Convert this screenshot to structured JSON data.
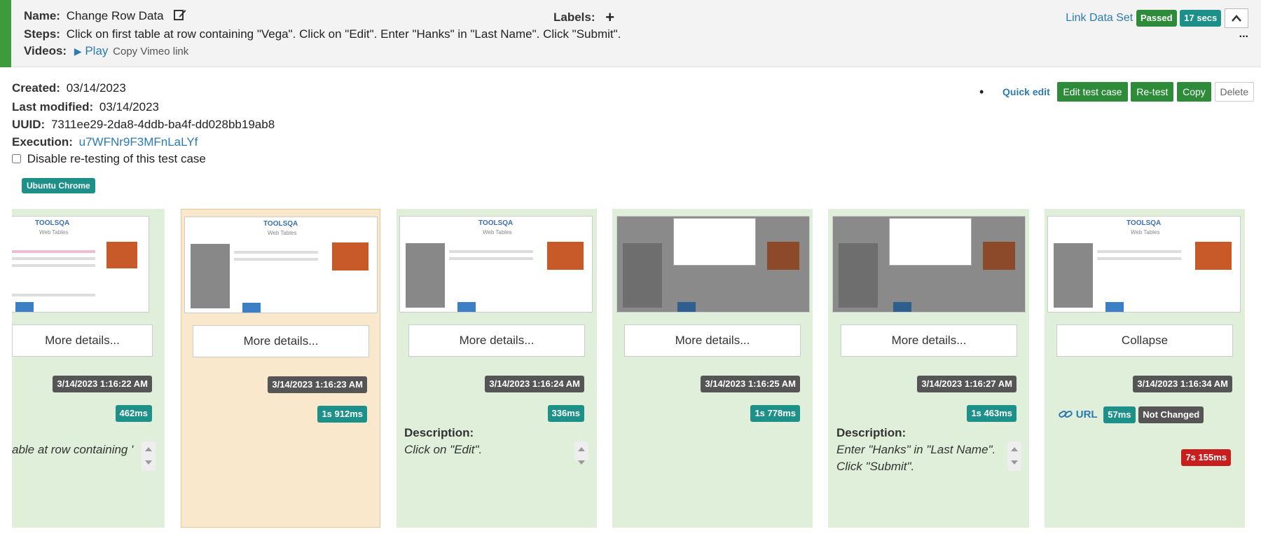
{
  "header": {
    "name_label": "Name:",
    "name_value": "Change Row Data",
    "labels_label": "Labels:",
    "steps_label": "Steps:",
    "steps_value": "Click on first table at row containing \"Vega\". Click on \"Edit\". Enter \"Hanks\" in \"Last Name\". Click \"Submit\".",
    "videos_label": "Videos:",
    "play_label": "Play",
    "copy_vimeo": "Copy Vimeo link",
    "link_data_set": "Link Data Set",
    "status_badge": "Passed",
    "duration_badge": "17 secs",
    "more_menu": "..."
  },
  "meta": {
    "created_label": "Created:",
    "created_value": "03/14/2023",
    "modified_label": "Last modified:",
    "modified_value": "03/14/2023",
    "uuid_label": "UUID:",
    "uuid_value": "7311ee29-2da8-4ddb-ba4f-dd028bb19ab8",
    "execution_label": "Execution:",
    "execution_value": "u7WFNr9F3MFnLaLYf",
    "disable_retest_label": "Disable re-testing of this test case",
    "browser_badge": "Ubuntu Chrome"
  },
  "actions": {
    "bullet": "•",
    "quick_edit": "Quick edit",
    "edit_test_case": "Edit test case",
    "retest": "Re-test",
    "copy": "Copy",
    "delete": "Delete"
  },
  "thumb_text": {
    "logo": "TOOLSQA",
    "subtitle": "Web Tables"
  },
  "steps": [
    {
      "button": "More details...",
      "timestamp": "3/14/2023 1:16:22 AM",
      "duration": "462ms",
      "description": "able at row containing \"Veg"
    },
    {
      "button": "More details...",
      "timestamp": "3/14/2023 1:16:23 AM",
      "duration": "1s 912ms"
    },
    {
      "button": "More details...",
      "timestamp": "3/14/2023 1:16:24 AM",
      "duration": "336ms",
      "description_label": "Description:",
      "description": "Click on \"Edit\"."
    },
    {
      "button": "More details...",
      "timestamp": "3/14/2023 1:16:25 AM",
      "duration": "1s 778ms"
    },
    {
      "button": "More details...",
      "timestamp": "3/14/2023 1:16:27 AM",
      "duration": "1s 463ms",
      "description_label": "Description:",
      "description_line1": "Enter \"Hanks\" in \"Last Name\".",
      "description_line2": "Click \"Submit\"."
    },
    {
      "button": "Collapse",
      "timestamp": "3/14/2023 1:16:34 AM",
      "url_label": "URL",
      "url_duration": "57ms",
      "url_status": "Not Changed",
      "total_duration": "7s 155ms"
    }
  ],
  "colors": {
    "passed": "#2e8b3a",
    "teal": "#1c9089",
    "card_green": "#dfefd9",
    "card_orange": "#f9e8cb",
    "error_red": "#c81e1e",
    "link": "#2b7bb0"
  }
}
